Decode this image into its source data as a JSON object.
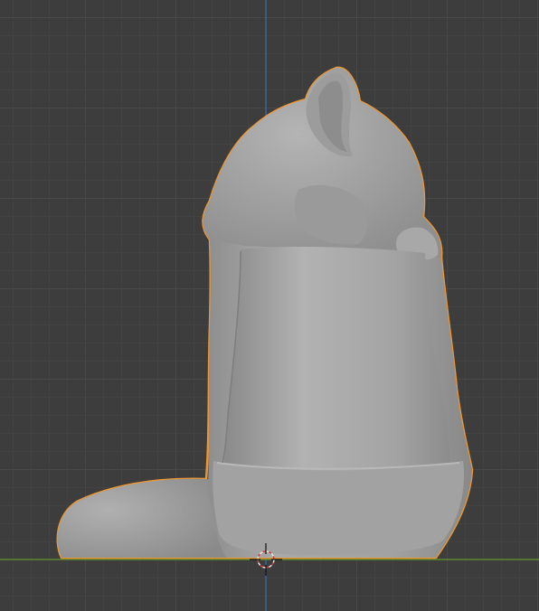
{
  "viewport": {
    "view": "side-orthographic",
    "object": "sculpted-cat-in-bag",
    "object_selected": true,
    "colors": {
      "background": "#3d3d3d",
      "grid_minor": "#464646",
      "grid_major": "#505050",
      "x_axis": "#5c8a2e",
      "z_axis": "#3a6fb5",
      "selection_outline": "#f0962e",
      "mesh": "#a6a6a6"
    },
    "icons": {
      "cursor": "3d-cursor-icon"
    }
  }
}
